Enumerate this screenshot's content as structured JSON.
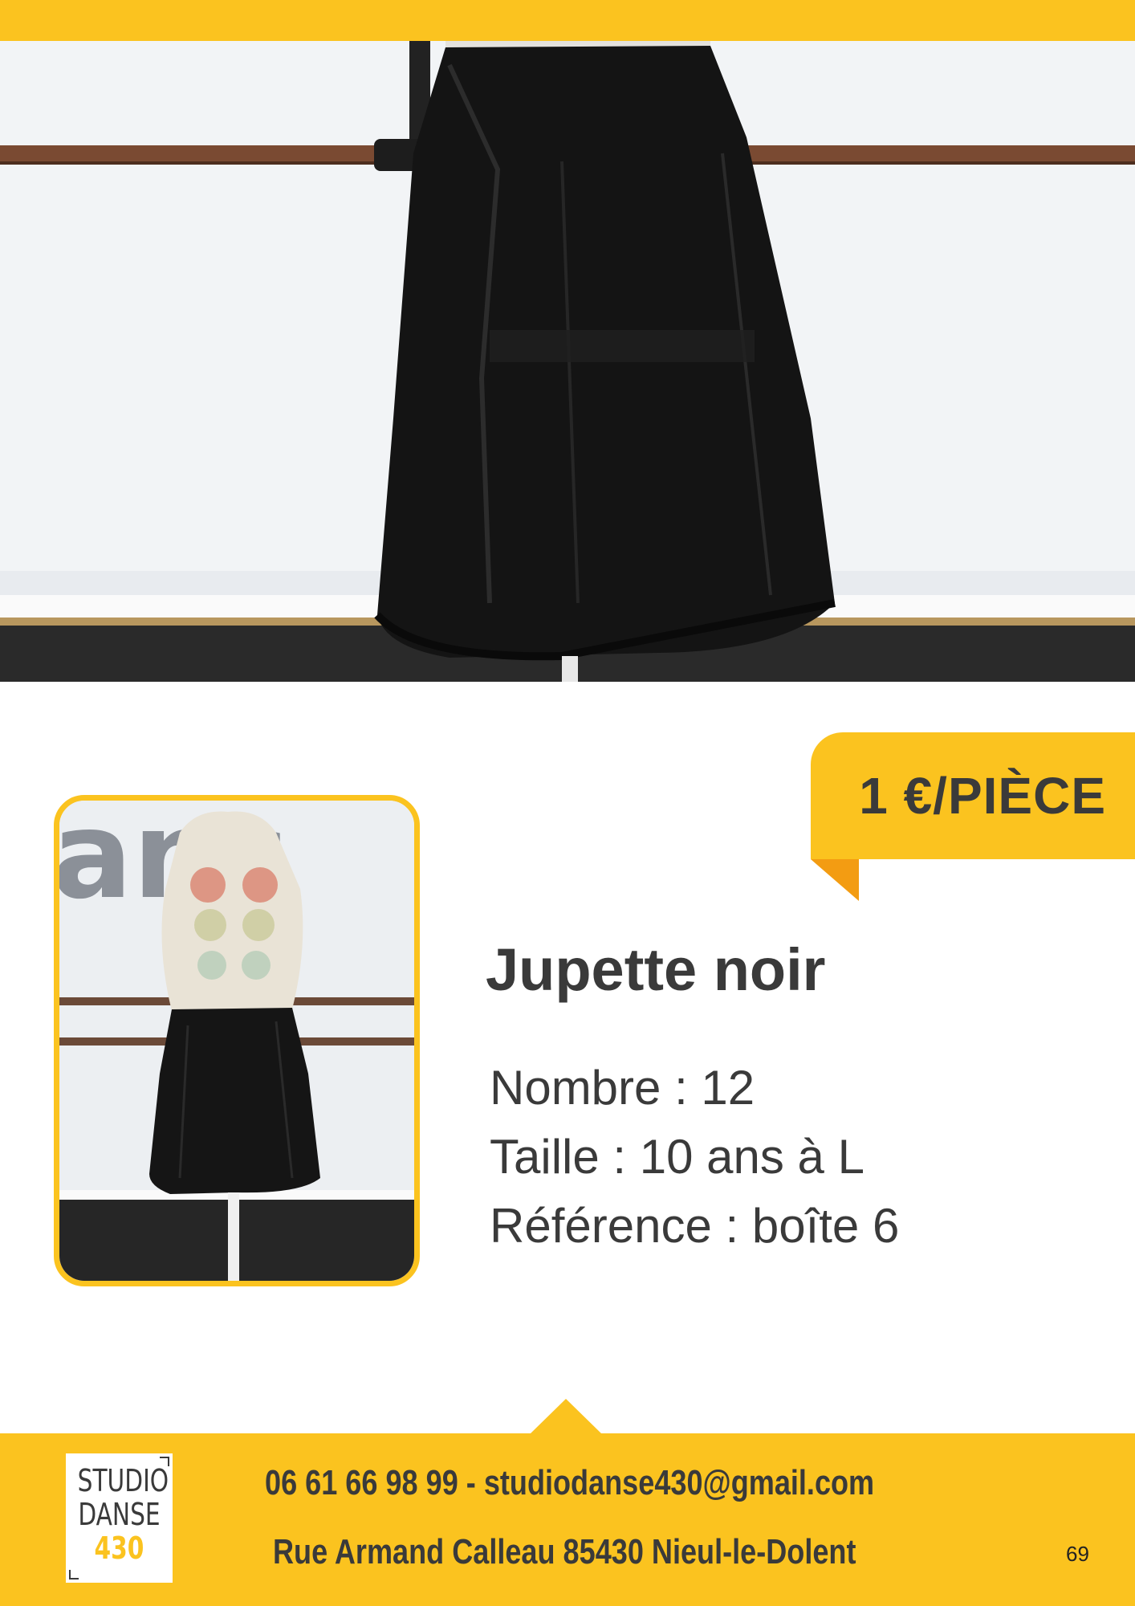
{
  "header": {
    "accent_color": "#fbc31f"
  },
  "hero_photo": {
    "subject": "black sheer skirt on mannequin in dance studio"
  },
  "price": {
    "label": "1 €/PIÈCE"
  },
  "thumbnail_photo": {
    "subject": "full mannequin wearing black skirt"
  },
  "product": {
    "title": "Jupette noir",
    "count_line": "Nombre : 12",
    "size_line": "Taille : 10 ans à L",
    "reference_line": "Référence : boîte 6"
  },
  "footer": {
    "logo": {
      "line1": "STUDIO",
      "line2": "DANSE",
      "line3": "430"
    },
    "contact": "06 61 66 98 99 - studiodanse430@gmail.com",
    "address": "Rue Armand Calleau 85430 Nieul-le-Dolent",
    "page_number": "69"
  },
  "colors": {
    "yellow": "#fbc31f",
    "orange_fold": "#f39c12",
    "text": "#3a3a3a"
  }
}
